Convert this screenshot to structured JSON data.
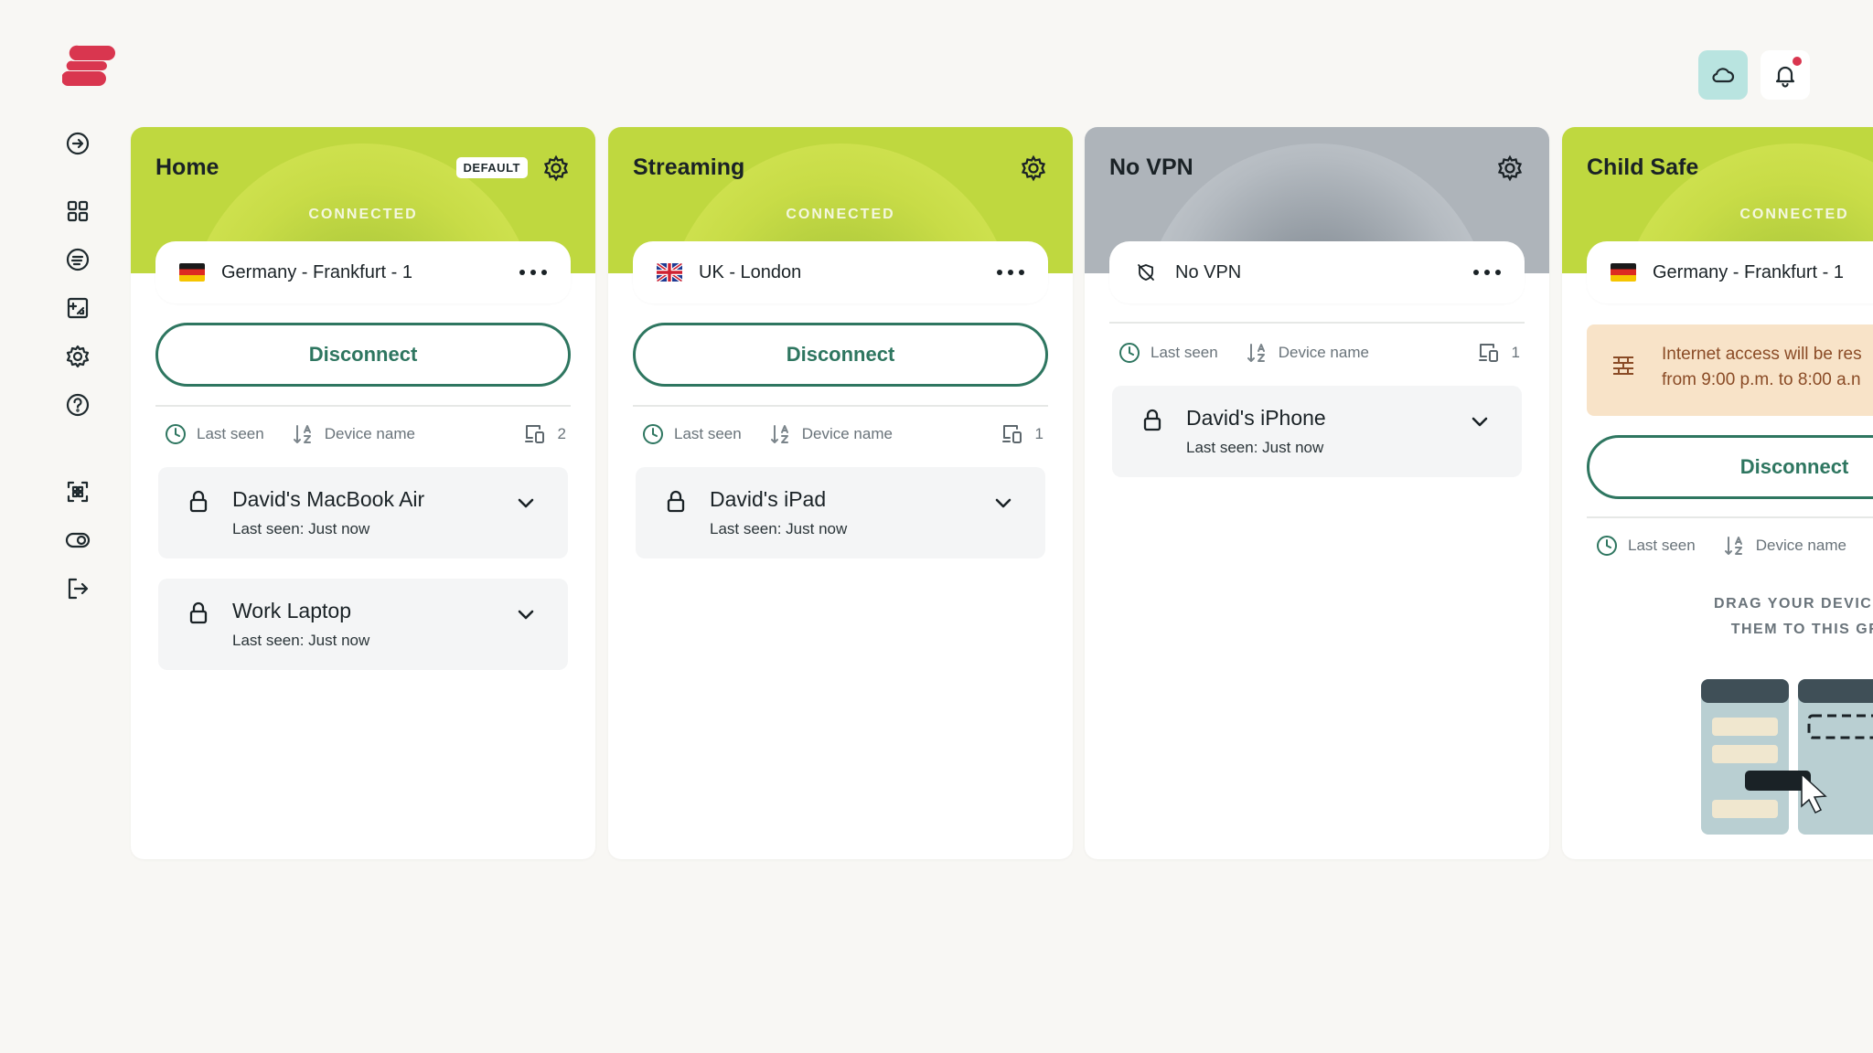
{
  "app": {
    "brand_color": "#d9364f",
    "accent_color": "#2e7660"
  },
  "sidebar": {
    "items": [
      {
        "name": "connect-icon"
      },
      {
        "name": "apps-grid-icon"
      },
      {
        "name": "speed-icon"
      },
      {
        "name": "add-device-icon"
      },
      {
        "name": "settings-icon"
      },
      {
        "name": "help-icon"
      },
      {
        "name": "qr-scan-icon"
      },
      {
        "name": "toggle-icon"
      },
      {
        "name": "sign-out-icon"
      }
    ]
  },
  "topbar": {
    "cloud_icon": "cloud-icon",
    "bell_icon": "bell-icon",
    "has_notification": true
  },
  "groups": [
    {
      "title": "Home",
      "badge": "DEFAULT",
      "status": "CONNECTED",
      "location": "Germany - Frankfurt - 1",
      "disconnect_label": "Disconnect",
      "sort_last_seen": "Last seen",
      "sort_device_name": "Device name",
      "device_count": "2",
      "devices": [
        {
          "name": "David's MacBook Air",
          "last_seen": "Last seen: Just now"
        },
        {
          "name": "Work Laptop",
          "last_seen": "Last seen: Just now"
        }
      ]
    },
    {
      "title": "Streaming",
      "status": "CONNECTED",
      "location": "UK - London",
      "disconnect_label": "Disconnect",
      "sort_last_seen": "Last seen",
      "sort_device_name": "Device name",
      "device_count": "1",
      "devices": [
        {
          "name": "David's iPad",
          "last_seen": "Last seen: Just now"
        }
      ]
    },
    {
      "title": "No VPN",
      "location": "No VPN",
      "sort_last_seen": "Last seen",
      "sort_device_name": "Device name",
      "device_count": "1",
      "devices": [
        {
          "name": "David's iPhone",
          "last_seen": "Last seen: Just now"
        }
      ]
    },
    {
      "title": "Child Safe",
      "status": "CONNECTED",
      "location": "Germany - Frankfurt - 1",
      "notice_line1": "Internet access will be res",
      "notice_line2": "from 9:00 p.m. to 8:00 a.n",
      "disconnect_label": "Disconnect",
      "sort_last_seen": "Last seen",
      "sort_device_name": "Device name",
      "drag_line1": "DRAG YOUR DEVICES TC",
      "drag_line2": "THEM TO THIS GROU"
    }
  ]
}
